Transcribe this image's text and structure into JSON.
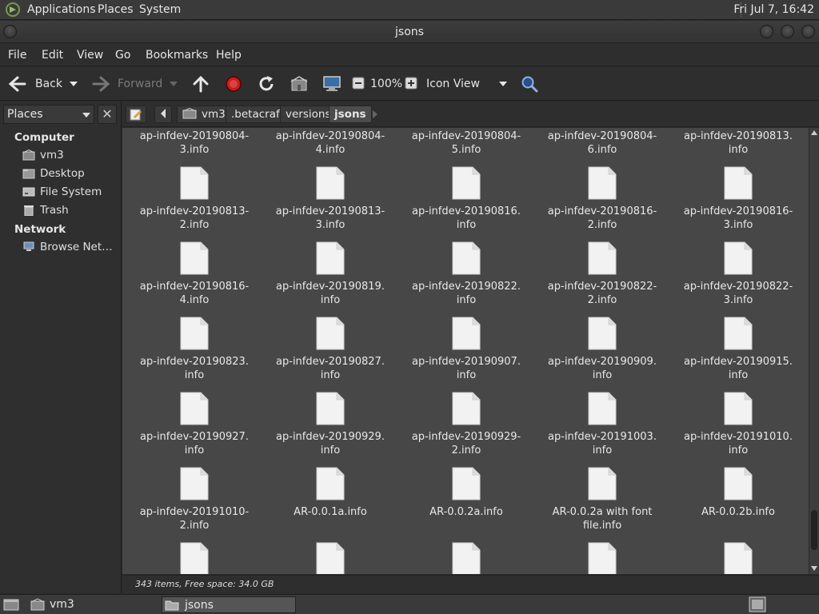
{
  "top_panel": {
    "menus": [
      "Applications",
      "Places",
      "System"
    ],
    "clock": "Fri Jul  7, 16:42"
  },
  "window": {
    "title": "jsons"
  },
  "menubar": [
    "File",
    "Edit",
    "View",
    "Go",
    "Bookmarks",
    "Help"
  ],
  "toolbar": {
    "back": "Back",
    "forward": "Forward",
    "zoom": "100%",
    "view_mode": "Icon View"
  },
  "sidepane": {
    "header": "Places",
    "sections": [
      {
        "title": "Computer",
        "items": [
          "vm3",
          "Desktop",
          "File System",
          "Trash"
        ]
      },
      {
        "title": "Network",
        "items": [
          "Browse Net…"
        ]
      }
    ]
  },
  "location": {
    "crumbs": [
      "vm3",
      ".betacraft",
      "versions",
      "jsons"
    ]
  },
  "files": [
    [
      "ap-infdev-20190804-",
      "3.info"
    ],
    [
      "ap-infdev-20190804-",
      "4.info"
    ],
    [
      "ap-infdev-20190804-",
      "5.info"
    ],
    [
      "ap-infdev-20190804-",
      "6.info"
    ],
    [
      "ap-infdev-20190813.",
      "info"
    ],
    [
      "ap-infdev-20190813-",
      "2.info"
    ],
    [
      "ap-infdev-20190813-",
      "3.info"
    ],
    [
      "ap-infdev-20190816.",
      "info"
    ],
    [
      "ap-infdev-20190816-",
      "2.info"
    ],
    [
      "ap-infdev-20190816-",
      "3.info"
    ],
    [
      "ap-infdev-20190816-",
      "4.info"
    ],
    [
      "ap-infdev-20190819.",
      "info"
    ],
    [
      "ap-infdev-20190822.",
      "info"
    ],
    [
      "ap-infdev-20190822-",
      "2.info"
    ],
    [
      "ap-infdev-20190822-",
      "3.info"
    ],
    [
      "ap-infdev-20190823.",
      "info"
    ],
    [
      "ap-infdev-20190827.",
      "info"
    ],
    [
      "ap-infdev-20190907.",
      "info"
    ],
    [
      "ap-infdev-20190909.",
      "info"
    ],
    [
      "ap-infdev-20190915.",
      "info"
    ],
    [
      "ap-infdev-20190927.",
      "info"
    ],
    [
      "ap-infdev-20190929.",
      "info"
    ],
    [
      "ap-infdev-20190929-",
      "2.info"
    ],
    [
      "ap-infdev-20191003.",
      "info"
    ],
    [
      "ap-infdev-20191010.",
      "info"
    ],
    [
      "ap-infdev-20191010-",
      "2.info"
    ],
    [
      "AR-0.0.1a.info",
      ""
    ],
    [
      "AR-0.0.2a.info",
      ""
    ],
    [
      "AR-0.0.2a with font",
      "file.info"
    ],
    [
      "AR-0.0.2b.info",
      ""
    ]
  ],
  "status": "343 items, Free space: 34.0 GB",
  "taskbar": [
    "vm3",
    "jsons"
  ]
}
